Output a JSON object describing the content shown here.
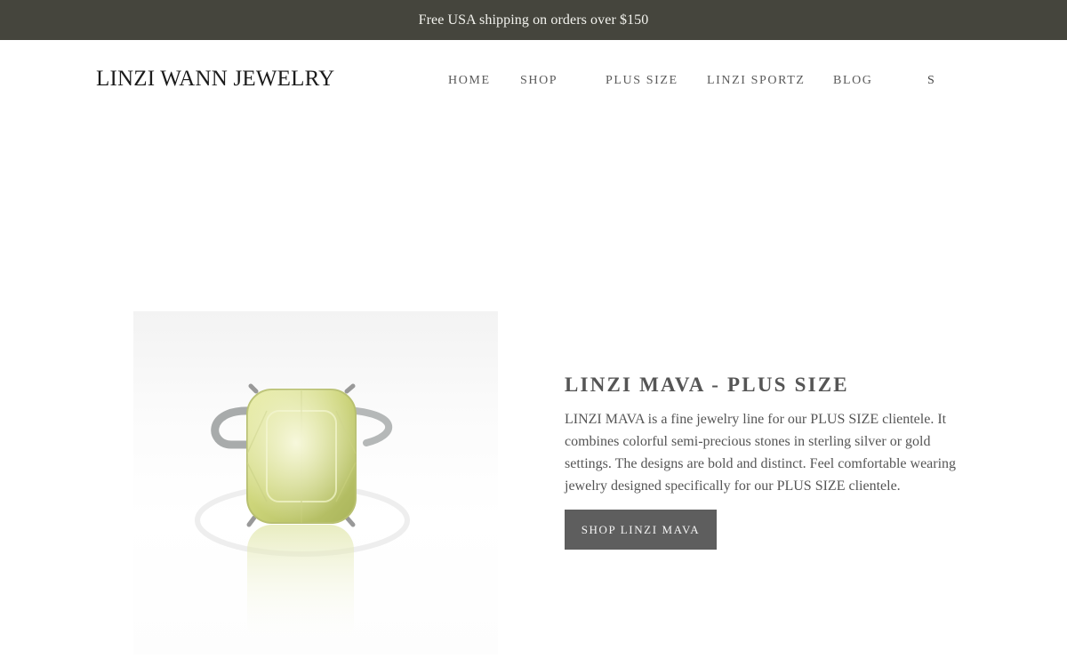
{
  "announcement": {
    "text": "Free USA shipping on orders over $150"
  },
  "header": {
    "logo": "LINZI WANN JEWELRY",
    "nav": {
      "home": "HOME",
      "shop": "SHOP",
      "plus_size": "PLUS SIZE",
      "linzi_sportz": "LINZI SPORTZ",
      "blog": "BLOG",
      "s": "S"
    }
  },
  "feature": {
    "title": "LINZI MAVA - PLUS SIZE",
    "description": "LINZI MAVA is a fine jewelry line for our PLUS SIZE clientele. It combines colorful semi-precious stones in sterling silver or gold settings. The designs are bold and distinct. Feel comfortable wearing jewelry designed specifically for our PLUS SIZE clientele.",
    "button_label": "SHOP LINZI MAVA",
    "image": {
      "subject": "ring-with-yellow-green-cushion-stone",
      "stone_color": "#d9e08a",
      "band_color": "#b9bcbc"
    }
  }
}
